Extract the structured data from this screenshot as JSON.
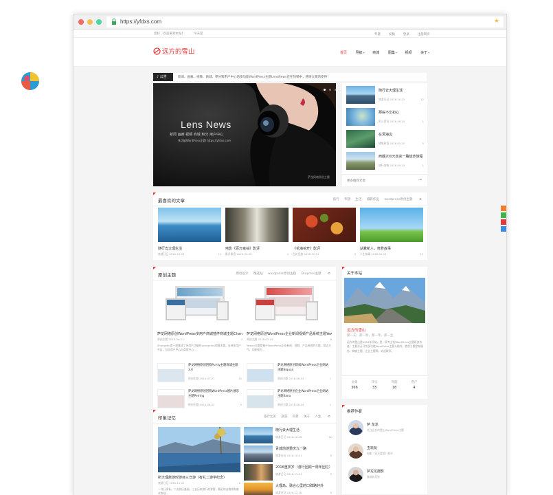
{
  "browser": {
    "url": "https://yfdxs.com"
  },
  "topbar": {
    "greeting": "您好，欢迎来到本站！",
    "date": "今天是",
    "weather": "",
    "links": [
      "专题",
      "投稿",
      "登录",
      "注册网页"
    ]
  },
  "site": {
    "logo_text": "远方的雪山",
    "nav": [
      "首页",
      "导航",
      "商城",
      "图集",
      "视频",
      "关于"
    ]
  },
  "notice": {
    "label": "公告",
    "text": "新闻、画廊、视频、商城、积分和用户中心的多功能WordPress主题LensNews正在热销中，感谢大家的支持！"
  },
  "slider": {
    "brand": "Lens News",
    "tagline": "新闻  画廊  视频  商城  积分  用户中心",
    "sub": "多功能WordPress主题  https://yfdxs.com",
    "watermark": "萨龙网络原创主题"
  },
  "side_list": {
    "items": [
      {
        "title": "随行去大理生活",
        "tag": "旅游日记",
        "date": "2016-10-25",
        "count": "12"
      },
      {
        "title": "那些不忘初心",
        "tag": "阿公资讯",
        "date": "2016-08-10",
        "count": "1"
      },
      {
        "title": "在洱海边",
        "tag": "随笔碎语",
        "date": "2016-05-20",
        "count": "5"
      },
      {
        "title": "西藏200元走完一路徒步旅程",
        "tag": "旅行攻略",
        "date": "2016-09-15",
        "count": "1"
      }
    ],
    "more": "更多推荐文章"
  },
  "popular": {
    "title": "最喜欢的文章",
    "tabs": [
      "旅行",
      "专题",
      "生活",
      "摄影作品",
      "wordpress原创主题"
    ],
    "items": [
      {
        "title": "随行去大理生活",
        "tag": "旅游日记",
        "date": "2016-10-25",
        "count": "12"
      },
      {
        "title": "电影《百万富翁》影评",
        "tag": "影评影音",
        "date": "2016-09-05",
        "count": "4"
      },
      {
        "title": "《花海花开》影评",
        "tag": "百花竞放",
        "date": "2016-12-21",
        "count": "3"
      },
      {
        "title": "站着新人，熊骨故事",
        "tag": "人生故事",
        "date": "2016-09-22",
        "count": "12"
      }
    ]
  },
  "themes": {
    "title": "原创主题",
    "tabs": [
      "原创设计",
      "精选站",
      "wordpress原创主题",
      "Dropress主题"
    ],
    "big": [
      {
        "title": "萨龙网络原创WordPress多用户商城插件商城主题ChanZK",
        "tag": "原创主题",
        "date": "2016-09-21",
        "count": "4",
        "desc": "Shangshu是一款集成了多用户功能的wordpress商城主题，支持多用户开店，包含用户中心与商家中心..."
      },
      {
        "title": "萨龙网络原创WordPress企业新闻视频产品系统主题Yewen",
        "tag": "原创主题",
        "date": "2016-07-15",
        "count": "8",
        "desc": "Yewen主题是基于WordPress企业新闻、视频、产品系统的主题，简洁大气，功能强大..."
      }
    ],
    "small": [
      {
        "title": "萨龙网络原创团购Purity主题商城主题3.0",
        "tag": "原创主题",
        "date": "2016-07-21",
        "count": "10"
      },
      {
        "title": "萨龙网络原创新闻WordPress企业网站主题Siquan",
        "tag": "原创主题",
        "date": "2016-06-02",
        "count": "1"
      },
      {
        "title": "萨龙网络原创团购WordPress图片展示主题Peiring",
        "tag": "原创主题",
        "date": "2016-06-02",
        "count": "5"
      },
      {
        "title": "萨龙网络原创企业WordPress企业网站主题Sanu",
        "tag": "原创主题",
        "date": "2016-06-04",
        "count": "1"
      }
    ]
  },
  "about": {
    "title": "关于本站",
    "site_name": "远方的雪山",
    "tagline": "那一天，那一秒，那一年，那一生",
    "desc": "远方的雪山是2016年开始，是一家专业的WordPress主题原创作者，主要设计开发多功能WordPress主题与插件，提供主题定制服务、商城主题、企业主题等，欢迎联系。",
    "stats": [
      {
        "label": "文章",
        "value": "366"
      },
      {
        "label": "评论",
        "value": "33"
      },
      {
        "label": "专题",
        "value": "18"
      },
      {
        "label": "用户",
        "value": "4"
      }
    ]
  },
  "travel": {
    "title": "印象记忆",
    "tabs": [
      "旅行之美",
      "旅游",
      "风景",
      "关于",
      "人生"
    ],
    "big": {
      "title": "所大理旅游时游目三日游（有礼二游学纪念）",
      "tag": "旅游日记",
      "date": "2016-11-02",
      "count": "8",
      "desc": "一点行家有，二去游历基础，三去历来旅行的游客，最近的去路线和基本常规..."
    },
    "list": [
      {
        "title": "随行去大理生活",
        "tag": "旅游日记",
        "date": "2016-10-26",
        "count": "12"
      },
      {
        "title": "青城前游重庆九一路",
        "tag": "旅游日记",
        "date": "2016-10-01",
        "count": "8"
      },
      {
        "title": "2016重庆岁（游行回顾一周年回忆）",
        "tag": "旅游日记",
        "date": "2016-11-01",
        "count": "3"
      },
      {
        "title": "大理岛，融合心里的口碑路好外",
        "tag": "旅游日记",
        "date": "2016-12-18",
        "count": "5"
      }
    ]
  },
  "authors": {
    "title": "推荐作者",
    "items": [
      {
        "name": "萨 龙龙",
        "desc": "关注远方的雪山WordPress主题"
      },
      {
        "name": "玉玩玩",
        "desc": "电影《百万富翁》影评"
      },
      {
        "name": "萨龙龙摄影",
        "desc": "旅游的足迹"
      }
    ]
  },
  "colors": {
    "accent": "#e83a3a",
    "dark": "#252525",
    "bg": "#f4f4f4"
  }
}
